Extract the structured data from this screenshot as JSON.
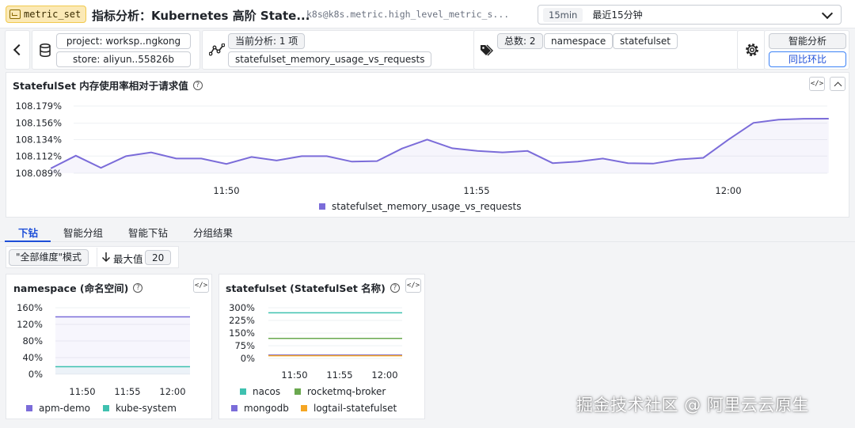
{
  "header": {
    "metric_tag": "metric_set",
    "title": "指标分析：Kubernetes 高阶 State...",
    "metric_path": "k8s@k8s.metric.high_level_metric_s...",
    "time_range_tag": "15min",
    "time_range_label": "最近15分钟"
  },
  "toolbar": {
    "project": "project: worksp..ngkong",
    "store": "store: aliyun..55826b",
    "current_analysis": "当前分析: 1 项",
    "metric_name": "statefulset_memory_usage_vs_requests",
    "total": "总数: 2",
    "dimensions": [
      "namespace",
      "statefulset"
    ],
    "smart_analysis": "智能分析",
    "yoy_mom": "同比环比"
  },
  "main_chart": {
    "title": "StatefulSet 内存使用率相对于请求值",
    "code_label": "</>"
  },
  "tabs": [
    "下钻",
    "智能分组",
    "智能下钻",
    "分组结果"
  ],
  "controls": {
    "mode": "\"全部维度\"模式",
    "max_label": "最大值",
    "max_value": "20"
  },
  "cards": {
    "namespace": {
      "title": "namespace (命名空间)"
    },
    "statefulset": {
      "title": "statefulset (StatefulSet 名称)"
    }
  },
  "watermark": "掘金技术社区 @ 阿里云云原生",
  "chart_data": [
    {
      "id": "main",
      "type": "area",
      "x": [
        "11:46:30",
        "11:47:00",
        "11:47:30",
        "11:48:00",
        "11:48:30",
        "11:49:00",
        "11:49:30",
        "11:50:00",
        "11:50:30",
        "11:51:00",
        "11:51:30",
        "11:52:00",
        "11:52:30",
        "11:53:00",
        "11:53:30",
        "11:54:00",
        "11:54:30",
        "11:55:00",
        "11:55:30",
        "11:56:00",
        "11:56:30",
        "11:57:00",
        "11:57:30",
        "11:58:00",
        "11:58:30",
        "11:59:00",
        "11:59:30",
        "12:00:00",
        "12:00:30",
        "12:01:00",
        "12:01:30",
        "12:02:00"
      ],
      "x_ticks": [
        "11:50",
        "11:55",
        "12:00"
      ],
      "y_ticks": [
        "108.179%",
        "108.156%",
        "108.134%",
        "108.112%",
        "108.089%"
      ],
      "ylim": [
        108.089,
        108.179
      ],
      "series": [
        {
          "name": "statefulset_memory_usage_vs_requests",
          "color": "#7b6cd9",
          "values": [
            108.0955,
            108.1125,
            108.0962,
            108.1119,
            108.1169,
            108.1087,
            108.1087,
            108.1015,
            108.1108,
            108.106,
            108.1119,
            108.1119,
            108.1046,
            108.1053,
            108.1221,
            108.1341,
            108.1225,
            108.1189,
            108.1169,
            108.1189,
            108.1025,
            108.1046,
            108.1087,
            108.1025,
            108.1019,
            108.1074,
            108.1096,
            108.1339,
            108.1565,
            108.1607,
            108.1619,
            108.1621
          ]
        }
      ],
      "legend": "bottom-center"
    },
    {
      "id": "namespace",
      "type": "area",
      "x_ticks": [
        "11:50",
        "11:55",
        "12:00"
      ],
      "y_ticks": [
        "160%",
        "120%",
        "80%",
        "40%",
        "0%"
      ],
      "ylim": [
        0,
        160
      ],
      "series": [
        {
          "name": "apm-demo",
          "color": "#7b6cd9",
          "values": [
            138,
            138,
            138,
            138,
            138,
            138,
            138
          ]
        },
        {
          "name": "kube-system",
          "color": "#3fc1b0",
          "values": [
            18,
            18,
            18,
            18,
            18,
            18,
            18
          ]
        }
      ],
      "legend": "bottom"
    },
    {
      "id": "statefulset",
      "type": "line",
      "x_ticks": [
        "11:50",
        "11:55",
        "12:00"
      ],
      "y_ticks": [
        "300%",
        "225%",
        "150%",
        "75%",
        "0%"
      ],
      "ylim": [
        0,
        300
      ],
      "series": [
        {
          "name": "nacos",
          "color": "#3fc1b0",
          "values": [
            270,
            270,
            270,
            270,
            270,
            270,
            270
          ]
        },
        {
          "name": "rocketmq-broker",
          "color": "#6aa84f",
          "values": [
            118,
            118,
            118,
            118,
            118,
            118,
            118
          ]
        },
        {
          "name": "mongodb",
          "color": "#7b6cd9",
          "values": [
            20,
            20,
            20,
            20,
            20,
            20,
            20
          ]
        },
        {
          "name": "logtail-statefulset",
          "color": "#f5a623",
          "values": [
            16,
            16,
            16,
            16,
            16,
            16,
            16
          ]
        }
      ],
      "legend": "bottom"
    }
  ]
}
